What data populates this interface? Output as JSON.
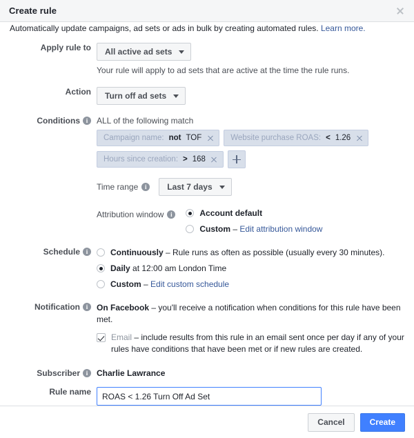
{
  "dialog": {
    "title": "Create rule",
    "close_icon": "close-icon",
    "intro_text": "Automatically update campaigns, ad sets or ads in bulk by creating automated rules.",
    "intro_link": "Learn more."
  },
  "apply_rule_to": {
    "label": "Apply rule to",
    "value": "All active ad sets",
    "helper": "Your rule will apply to ad sets that are active at the time the rule runs."
  },
  "action": {
    "label": "Action",
    "value": "Turn off ad sets"
  },
  "conditions": {
    "label": "Conditions",
    "info_icon": "info-icon",
    "heading": "ALL of the following match",
    "pills": [
      {
        "name": "Campaign name:",
        "operator": "not",
        "value": "TOF",
        "remove_icon": "close-icon"
      },
      {
        "name": "Website purchase ROAS:",
        "operator": "<",
        "value": "1.26",
        "remove_icon": "close-icon"
      },
      {
        "name": "Hours since creation:",
        "operator": ">",
        "value": "168",
        "remove_icon": "close-icon"
      }
    ],
    "add_button_icon": "plus-icon"
  },
  "time_range": {
    "label": "Time range",
    "info_icon": "info-icon",
    "value": "Last 7 days"
  },
  "attribution_window": {
    "label": "Attribution window",
    "info_icon": "info-icon",
    "options": [
      {
        "bold": "Account default",
        "rest": "",
        "link": "",
        "selected": true
      },
      {
        "bold": "Custom",
        "rest": " – ",
        "link": "Edit attribution window",
        "selected": false
      }
    ]
  },
  "schedule": {
    "label": "Schedule",
    "info_icon": "info-icon",
    "options": [
      {
        "bold": "Continuously",
        "rest": " – Rule runs as often as possible (usually every 30 minutes).",
        "link": "",
        "selected": false
      },
      {
        "bold": "Daily",
        "rest": " at 12:00 am London Time",
        "link": "",
        "selected": true
      },
      {
        "bold": "Custom",
        "rest": " – ",
        "link": "Edit custom schedule",
        "selected": false
      }
    ]
  },
  "notification": {
    "label": "Notification",
    "info_icon": "info-icon",
    "on_facebook_bold": "On Facebook",
    "on_facebook_rest": " – you'll receive a notification when conditions for this rule have been met.",
    "email_checked": true,
    "email_label": "Email",
    "email_rest": " – include results from this rule in an email sent once per day if any of your rules have conditions that have been met or if new rules are created."
  },
  "subscriber": {
    "label": "Subscriber",
    "info_icon": "info-icon",
    "value": "Charlie Lawrance"
  },
  "rule_name": {
    "label": "Rule name",
    "value": "ROAS < 1.26 Turn Off Ad Set",
    "placeholder": "Rule name"
  },
  "footer": {
    "cancel_label": "Cancel",
    "create_label": "Create"
  },
  "colors": {
    "accent": "#4080ff",
    "link": "#365899",
    "pill_bg": "#d8dfea",
    "pill_text": "#9aa6bd",
    "header_bg": "#f5f6f7",
    "label_text": "#4b4f56"
  }
}
